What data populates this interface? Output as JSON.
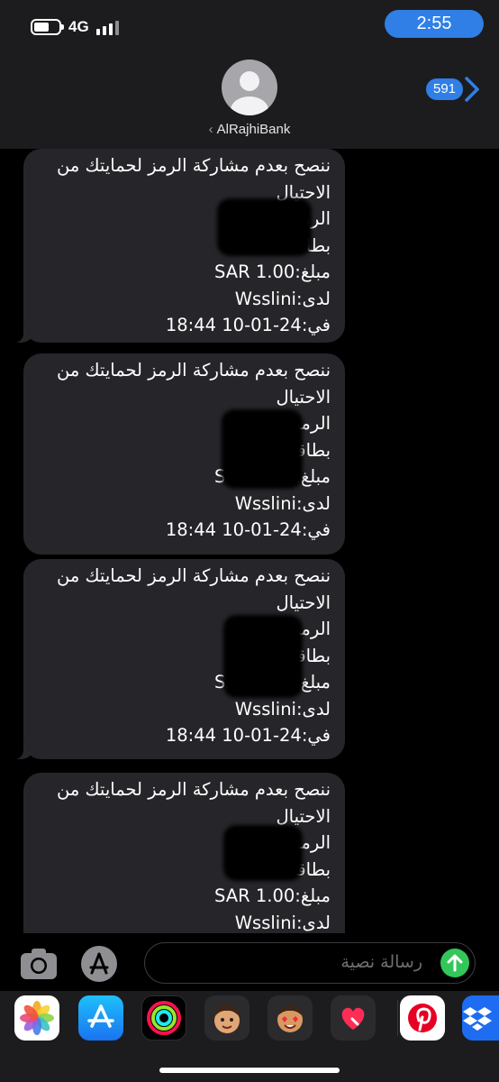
{
  "status_bar": {
    "time": "2:55",
    "network": "4G",
    "battery_level": 0.6
  },
  "conversation": {
    "contact": "AlRajhiBank",
    "back_count": "591",
    "avatar_icon": "person-icon"
  },
  "messages": [
    {
      "line1": "ننصح بعدم مشاركة الرمز لحمايتك من",
      "line2": "الاحتيال",
      "code_label": "الرمز:",
      "card_label": "بطاقة:",
      "amount": "مبلغ:SAR 1.00",
      "merchant": "لدى:Wsslini",
      "date": "في:24-01-10 18:44"
    },
    {
      "line1": "ننصح بعدم مشاركة الرمز لحمايتك من",
      "line2": "الاحتيال",
      "code_label": "الرمز:",
      "card_label": "بطاقة:",
      "amount": "مبلغ:SAR 1.00",
      "merchant": "لدى:Wsslini",
      "date": "في:24-01-10 18:44"
    },
    {
      "line1": "ننصح بعدم مشاركة الرمز لحمايتك من",
      "line2": "الاحتيال",
      "code_label": "الرمز:",
      "card_label": "بطاقة:",
      "amount": "مبلغ:SAR 1.00",
      "merchant": "لدى:Wsslini",
      "date": "في:24-01-10 18:44"
    },
    {
      "line1": "ننصح بعدم مشاركة الرمز لحمايتك من",
      "line2": "الاحتيال",
      "code_label": "الرمز:",
      "card_label": "بطاقة:",
      "amount": "مبلغ:SAR 1.00",
      "merchant": "لدى:Wsslini"
    }
  ],
  "composer": {
    "placeholder": "رسالة نصية",
    "camera_icon": "camera-icon",
    "apps_icon": "app-store-icon",
    "send_icon": "send-arrow-icon"
  },
  "app_drawer": {
    "apps": [
      {
        "name": "photos-icon",
        "color": "#ffffff"
      },
      {
        "name": "app-store-icon",
        "color": "#1a8cf6"
      },
      {
        "name": "activity-icon",
        "color": "#000000"
      },
      {
        "name": "memoji-icon",
        "color": "#2b2b2e"
      },
      {
        "name": "memoji-stickers-icon",
        "color": "#2b2b2e"
      },
      {
        "name": "digital-touch-icon",
        "color": "#2b2b2e"
      },
      {
        "name": "pinterest-icon",
        "color": "#ffffff"
      },
      {
        "name": "dropbox-icon",
        "color": "#1e6cf1"
      }
    ]
  },
  "colors": {
    "bubble": "#26262a",
    "accent": "#2f7fe6",
    "send": "#33c75a"
  }
}
